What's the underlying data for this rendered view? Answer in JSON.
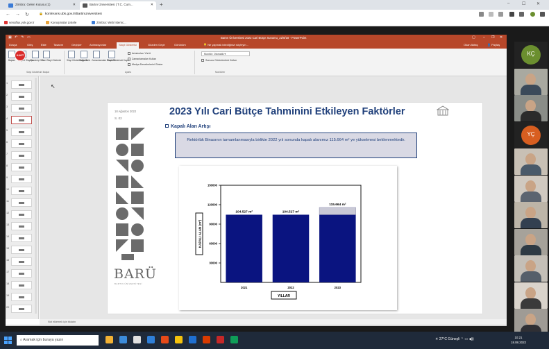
{
  "browser": {
    "tabs": [
      {
        "label": "Zimbra: Gelen Kutusu (1)",
        "favicon_color": "#3b7bd6"
      },
      {
        "label": "Bartın Üniversitesi | T.C. Cum...",
        "favicon_color": "#555555"
      }
    ],
    "new_tab": "+",
    "window_controls": [
      "‒",
      "☐",
      "✕"
    ],
    "url": "konferans.ubk.gov.tr/BartinUniversitesi",
    "bookmarks": [
      "senaflux.yok.gov.tr",
      "Konuşmalar Listele",
      "Zimbra: Web İstemc..."
    ]
  },
  "powerpoint": {
    "title": "Bartın Üniversitesi 2022 Cari Bütçe Sunumu_22/8/18 - PowerPoint",
    "ribbon_tabs": [
      "Dosya",
      "Giriş",
      "Ekle",
      "Tasarım",
      "Geçişler",
      "Animasyonlar",
      "Slayt Gösterisi",
      "Gözden Geçir",
      "Görünüm"
    ],
    "selected_tab": "Slayt Gösterisi",
    "tell_me": "Ne yapmak istediğinizi söyleyin...",
    "share_label": "Paylaş",
    "user": "Okan Aktaş",
    "ribbon_buttons": [
      "Baştan",
      "Geçerli Slayttan",
      "Çevrimiçi Sun",
      "Özel Slayt Gösterisi",
      "Slayt Gösterisi Ayarla",
      "Slaytı Gizle",
      "Zamanlamaları Prova Et",
      "Slayt Gösterisini Kaydet"
    ],
    "ribbon_checks": [
      "Anlatımları Yürüt",
      "Zamanlamaları Kullan",
      "Medya Denetimlerini Göster"
    ],
    "monitor_label": "Monitör:",
    "monitor_value": "Otomatik",
    "presenter_view": "Sunucu Görünümünü Kullan",
    "groups": [
      "Slayt Gösterisini Başlat",
      "Ayarla",
      "Monitörler"
    ],
    "rec_badge": "KAYIT",
    "notes_placeholder": "Not eklemek için tıklatın",
    "thumb_numbers": [
      "1",
      "2",
      "3",
      "4",
      "5",
      "6",
      "7",
      "8",
      "9",
      "10",
      "11",
      "12",
      "13",
      "14",
      "15",
      "16",
      "17",
      "18",
      "19",
      "20"
    ],
    "selected_thumb": "4"
  },
  "slide": {
    "date": "18 Ağustos 2022",
    "slide_no": "S. 02",
    "title": "2023 Yılı Cari Bütçe Tahminini Etkileyen Faktörler",
    "bullet": "Kapalı Alan Artışı",
    "text_box": "Rektörlük Binasının tamamlanmasıyla birlikte 2022 yılı sonunda kapalı alanımız 115.664 m² ye yükselmesi beklenmektedir.",
    "logo": "BARÜ",
    "logo_sub": "BARTIN ÜNİVERSİTESİ"
  },
  "chart_data": {
    "type": "bar",
    "categories": [
      "2021",
      "2022",
      "2023"
    ],
    "values": [
      104527,
      104527,
      115664
    ],
    "data_labels": [
      "104.527 m²",
      "104.527 m²",
      "115.664 m²"
    ],
    "xlabel": "YILLAR",
    "ylabel": "KAPALI ALAN (m²)",
    "ylim": [
      0,
      150000
    ],
    "y_ticks": [
      "30000",
      "60000",
      "90000",
      "120000",
      "150000"
    ],
    "bar_color": "#0a1480",
    "increment_color": "#c9c9d6"
  },
  "participants": [
    {
      "kind": "initials",
      "text": "KÇ",
      "color": "#6b8f2f"
    },
    {
      "kind": "camera",
      "shirt": "#3b4a5a",
      "bg": "#a9a9a0"
    },
    {
      "kind": "camera",
      "shirt": "#2b2b2b",
      "bg": "#8a8d88"
    },
    {
      "kind": "initials",
      "text": "YÇ",
      "color": "#d85e20"
    },
    {
      "kind": "camera",
      "shirt": "#4a5a6a",
      "bg": "#c8c0b5"
    },
    {
      "kind": "camera",
      "shirt": "#5b6470",
      "bg": "#d0c9c0"
    },
    {
      "kind": "camera",
      "shirt": "#334050",
      "bg": "#bdb5a8"
    },
    {
      "kind": "camera",
      "shirt": "#2e3a44",
      "bg": "#a6a29a"
    },
    {
      "kind": "camera",
      "shirt": "#555f6a",
      "bg": "#c4bfb7"
    },
    {
      "kind": "camera",
      "shirt": "#3a3a3a",
      "bg": "#d9d3cb"
    },
    {
      "kind": "camera",
      "shirt": "#2f2f34",
      "bg": "#9f9b95"
    }
  ],
  "taskbar": {
    "search_placeholder": "Aramak için buraya yazın",
    "weather": "27°C Güneşli",
    "time": "10:21",
    "date": "18.08.2022",
    "app_colors": [
      "#f2b134",
      "#3c8bd9",
      "#e0e0e0",
      "#2f7fd8",
      "#e64a19",
      "#f4c20d",
      "#1f6fd0",
      "#d83b01",
      "#c62828",
      "#0f9d58"
    ]
  }
}
